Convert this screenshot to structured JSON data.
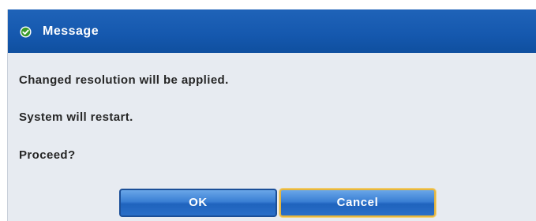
{
  "dialog": {
    "title": "Message",
    "title_icon": "check-circle-icon",
    "messages": [
      "Changed resolution will be applied.",
      "System will restart.",
      "Proceed?"
    ],
    "buttons": {
      "ok_label": "OK",
      "cancel_label": "Cancel"
    },
    "colors": {
      "titlebar": "#1558ae",
      "body": "#e7ebf1",
      "button": "#2a6fc8",
      "focus_outline": "#e7b73f",
      "icon": "#3a9a2a"
    },
    "focused_button": "Cancel"
  }
}
